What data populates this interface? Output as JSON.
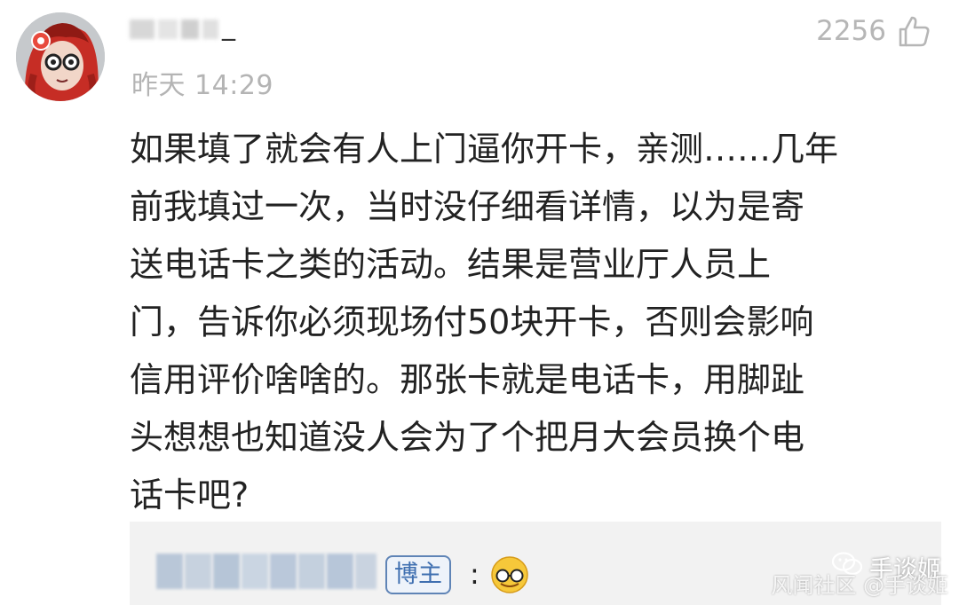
{
  "comment": {
    "username_visible_tail": "_",
    "timestamp": "昨天 14:29",
    "likes": "2256",
    "text_lines": [
      "如果填了就会有人上门逼你开卡，亲测……几年",
      "前我填过一次，当时没仔细看详情，以为是寄",
      "送电话卡之类的活动。结果是营业厅人员上",
      "门，告诉你必须现场付50块开卡，否则会影响",
      "信用评价啥啥的。那张卡就是电话卡，用脚趾",
      "头想想也知道没人会为了个把月大会员换个电",
      "话卡吧?"
    ]
  },
  "reply": {
    "tag": "博主",
    "colon": ":"
  },
  "watermark": {
    "line1": "手谈姬",
    "line2": "风闻社区 @手谈姬"
  },
  "icons": {
    "like": "thumbs-up-icon",
    "emoji": "glasses-emoji-icon",
    "wechat": "wechat-icon"
  },
  "colors": {
    "secondary_text": "#b4b4b4",
    "reply_background": "#f2f2f2",
    "tag_blue": "#3f6fb0"
  }
}
